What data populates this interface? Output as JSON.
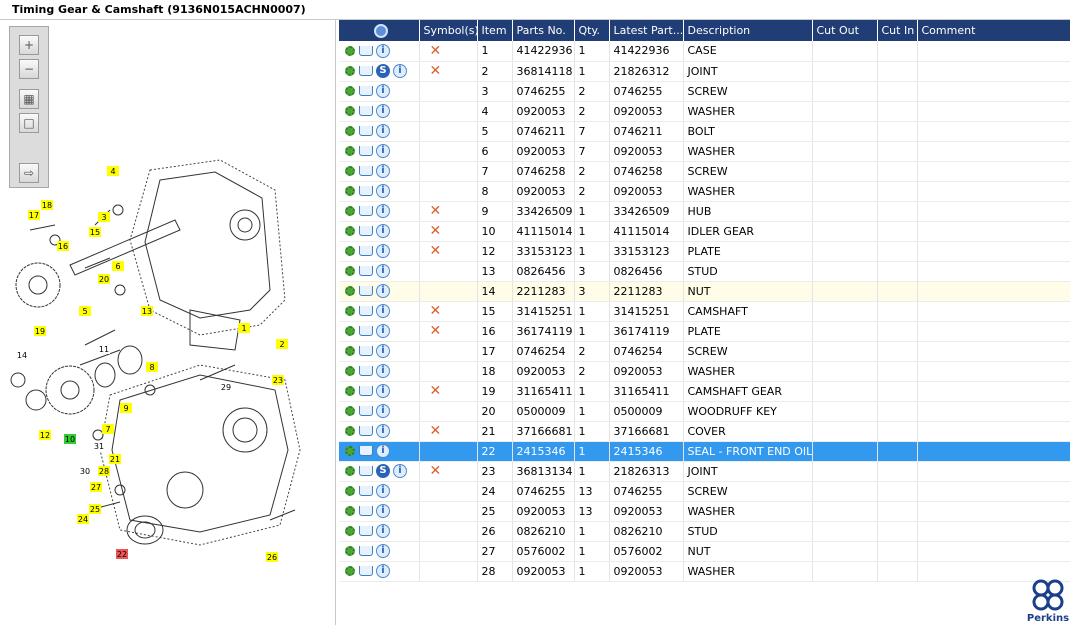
{
  "window": {
    "title": "Timing Gear & Camshaft (9136N015ACHN0007)"
  },
  "toolbar": {
    "buttons": [
      {
        "name": "zoom-in-button",
        "glyph": "+"
      },
      {
        "name": "zoom-out-button",
        "glyph": "−"
      },
      {
        "name": "fit-all-button",
        "glyph": "▦"
      },
      {
        "name": "fit-window-button",
        "glyph": "□"
      },
      {
        "name": "export-button",
        "glyph": "⇨"
      }
    ]
  },
  "diagram": {
    "callouts": [
      {
        "label": "4",
        "color": "#ffff00"
      },
      {
        "label": "18",
        "color": "#ffff00"
      },
      {
        "label": "17",
        "color": "#ffff00"
      },
      {
        "label": "3",
        "color": "#ffff00"
      },
      {
        "label": "16",
        "color": "#ffff00"
      },
      {
        "label": "15",
        "color": "#ffff00"
      },
      {
        "label": "6",
        "color": "#ffff00"
      },
      {
        "label": "20",
        "color": "#ffff00"
      },
      {
        "label": "5",
        "color": "#ffff00"
      },
      {
        "label": "13",
        "color": "#ffff00"
      },
      {
        "label": "19",
        "color": "#ffff00"
      },
      {
        "label": "1",
        "color": "#ffff00"
      },
      {
        "label": "2",
        "color": "#ffff00"
      },
      {
        "label": "11",
        "color": "#ffffff"
      },
      {
        "label": "14",
        "color": "#ffffff"
      },
      {
        "label": "8",
        "color": "#ffff00"
      },
      {
        "label": "23",
        "color": "#ffff00"
      },
      {
        "label": "29",
        "color": "#ffffff"
      },
      {
        "label": "9",
        "color": "#ffff00"
      },
      {
        "label": "7",
        "color": "#ffff00"
      },
      {
        "label": "12",
        "color": "#ffff00"
      },
      {
        "label": "10",
        "color": "#33cc33"
      },
      {
        "label": "31",
        "color": "#ffffff"
      },
      {
        "label": "21",
        "color": "#ffff00"
      },
      {
        "label": "30",
        "color": "#ffffff"
      },
      {
        "label": "28",
        "color": "#ffff00"
      },
      {
        "label": "27",
        "color": "#ffff00"
      },
      {
        "label": "25",
        "color": "#ffff00"
      },
      {
        "label": "24",
        "color": "#ffff00"
      },
      {
        "label": "22",
        "color": "#ee5555"
      },
      {
        "label": "26",
        "color": "#ffff00"
      }
    ]
  },
  "grid": {
    "headers": {
      "symbols": "Symbol(s)",
      "item": "Item",
      "part_no": "Parts No.",
      "qty": "Qty.",
      "latest_part": "Latest Part...",
      "description": "Description",
      "cut_out": "Cut Out",
      "cut_in": "Cut In",
      "comment": "Comment"
    },
    "rows": [
      {
        "item": "1",
        "part_no": "41422936",
        "qty": "1",
        "latest": "41422936",
        "desc": "CASE",
        "cross": true,
        "s": false,
        "state": ""
      },
      {
        "item": "2",
        "part_no": "36814118",
        "qty": "1",
        "latest": "21826312",
        "desc": "JOINT",
        "cross": true,
        "s": true,
        "state": ""
      },
      {
        "item": "3",
        "part_no": "0746255",
        "qty": "2",
        "latest": "0746255",
        "desc": "SCREW",
        "cross": false,
        "s": false,
        "state": ""
      },
      {
        "item": "4",
        "part_no": "0920053",
        "qty": "2",
        "latest": "0920053",
        "desc": "WASHER",
        "cross": false,
        "s": false,
        "state": ""
      },
      {
        "item": "5",
        "part_no": "0746211",
        "qty": "7",
        "latest": "0746211",
        "desc": "BOLT",
        "cross": false,
        "s": false,
        "state": ""
      },
      {
        "item": "6",
        "part_no": "0920053",
        "qty": "7",
        "latest": "0920053",
        "desc": "WASHER",
        "cross": false,
        "s": false,
        "state": ""
      },
      {
        "item": "7",
        "part_no": "0746258",
        "qty": "2",
        "latest": "0746258",
        "desc": "SCREW",
        "cross": false,
        "s": false,
        "state": ""
      },
      {
        "item": "8",
        "part_no": "0920053",
        "qty": "2",
        "latest": "0920053",
        "desc": "WASHER",
        "cross": false,
        "s": false,
        "state": ""
      },
      {
        "item": "9",
        "part_no": "33426509",
        "qty": "1",
        "latest": "33426509",
        "desc": "HUB",
        "cross": true,
        "s": false,
        "state": ""
      },
      {
        "item": "10",
        "part_no": "41115014",
        "qty": "1",
        "latest": "41115014",
        "desc": "IDLER GEAR",
        "cross": true,
        "s": false,
        "state": ""
      },
      {
        "item": "12",
        "part_no": "33153123",
        "qty": "1",
        "latest": "33153123",
        "desc": "PLATE",
        "cross": true,
        "s": false,
        "state": ""
      },
      {
        "item": "13",
        "part_no": "0826456",
        "qty": "3",
        "latest": "0826456",
        "desc": "STUD",
        "cross": false,
        "s": false,
        "state": ""
      },
      {
        "item": "14",
        "part_no": "2211283",
        "qty": "3",
        "latest": "2211283",
        "desc": "NUT",
        "cross": false,
        "s": false,
        "state": "hl"
      },
      {
        "item": "15",
        "part_no": "31415251",
        "qty": "1",
        "latest": "31415251",
        "desc": "CAMSHAFT",
        "cross": true,
        "s": false,
        "state": ""
      },
      {
        "item": "16",
        "part_no": "36174119",
        "qty": "1",
        "latest": "36174119",
        "desc": "PLATE",
        "cross": true,
        "s": false,
        "state": ""
      },
      {
        "item": "17",
        "part_no": "0746254",
        "qty": "2",
        "latest": "0746254",
        "desc": "SCREW",
        "cross": false,
        "s": false,
        "state": ""
      },
      {
        "item": "18",
        "part_no": "0920053",
        "qty": "2",
        "latest": "0920053",
        "desc": "WASHER",
        "cross": false,
        "s": false,
        "state": ""
      },
      {
        "item": "19",
        "part_no": "31165411",
        "qty": "1",
        "latest": "31165411",
        "desc": "CAMSHAFT GEAR",
        "cross": true,
        "s": false,
        "state": ""
      },
      {
        "item": "20",
        "part_no": "0500009",
        "qty": "1",
        "latest": "0500009",
        "desc": "WOODRUFF KEY",
        "cross": false,
        "s": false,
        "state": ""
      },
      {
        "item": "21",
        "part_no": "37166681",
        "qty": "1",
        "latest": "37166681",
        "desc": "COVER",
        "cross": true,
        "s": false,
        "state": ""
      },
      {
        "item": "22",
        "part_no": "2415346",
        "qty": "1",
        "latest": "2415346",
        "desc": "SEAL - FRONT END OIL",
        "cross": false,
        "s": false,
        "state": "sel"
      },
      {
        "item": "23",
        "part_no": "36813134",
        "qty": "1",
        "latest": "21826313",
        "desc": "JOINT",
        "cross": true,
        "s": true,
        "state": ""
      },
      {
        "item": "24",
        "part_no": "0746255",
        "qty": "13",
        "latest": "0746255",
        "desc": "SCREW",
        "cross": false,
        "s": false,
        "state": ""
      },
      {
        "item": "25",
        "part_no": "0920053",
        "qty": "13",
        "latest": "0920053",
        "desc": "WASHER",
        "cross": false,
        "s": false,
        "state": ""
      },
      {
        "item": "26",
        "part_no": "0826210",
        "qty": "1",
        "latest": "0826210",
        "desc": "STUD",
        "cross": false,
        "s": false,
        "state": ""
      },
      {
        "item": "27",
        "part_no": "0576002",
        "qty": "1",
        "latest": "0576002",
        "desc": "NUT",
        "cross": false,
        "s": false,
        "state": ""
      },
      {
        "item": "28",
        "part_no": "0920053",
        "qty": "1",
        "latest": "0920053",
        "desc": "WASHER",
        "cross": false,
        "s": false,
        "state": ""
      }
    ]
  },
  "brand": {
    "logo_text": "Perkins",
    "color": "#1b3f8a"
  },
  "colors": {
    "header": "#203d75",
    "selected": "#3399ee",
    "highlight": "#fffde8",
    "cross": "#e0602a"
  }
}
